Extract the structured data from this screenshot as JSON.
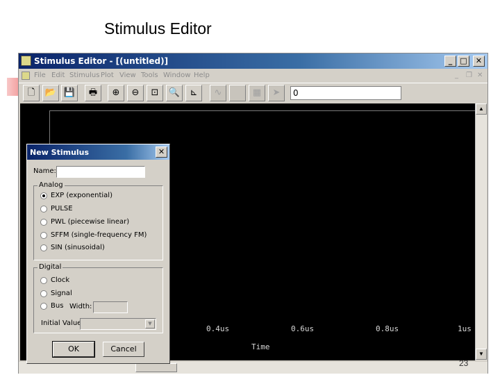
{
  "slide": {
    "title": "Stimulus Editor",
    "page_number": "23"
  },
  "window": {
    "title": "Stimulus Editor - [(untitled)]",
    "controls": {
      "minimize": "_",
      "maximize": "□",
      "close": "✕"
    },
    "mdi_controls": {
      "minimize": "_",
      "restore": "❐",
      "close": "✕"
    }
  },
  "menu": [
    "File",
    "Edit",
    "Stimulus",
    "Plot",
    "View",
    "Tools",
    "Window",
    "Help"
  ],
  "toolbar": {
    "buttons": [
      {
        "name": "new-file-button",
        "icon": "new-file-icon",
        "glyph": "🗋",
        "enabled": true
      },
      {
        "name": "open-button",
        "icon": "folder-open-icon",
        "glyph": "📂",
        "enabled": true
      },
      {
        "name": "save-button",
        "icon": "floppy-icon",
        "glyph": "💾",
        "enabled": true
      },
      {
        "name": "print-button",
        "icon": "printer-icon",
        "glyph": "🖶",
        "enabled": true
      },
      {
        "name": "zoom-in-button",
        "icon": "zoom-in-icon",
        "glyph": "⊕",
        "enabled": true
      },
      {
        "name": "zoom-out-button",
        "icon": "zoom-out-icon",
        "glyph": "⊖",
        "enabled": true
      },
      {
        "name": "zoom-area-button",
        "icon": "zoom-area-icon",
        "glyph": "⊡",
        "enabled": true
      },
      {
        "name": "zoom-fit-button",
        "icon": "zoom-fit-icon",
        "glyph": "🔍",
        "enabled": true
      },
      {
        "name": "axis-settings-button",
        "icon": "axis-icon",
        "glyph": "⊾",
        "enabled": true
      },
      {
        "name": "add-trace-button",
        "icon": "waveform-icon",
        "glyph": "∿",
        "enabled": false
      },
      {
        "name": "blank-tool-button",
        "icon": "blank-icon",
        "glyph": "",
        "enabled": false
      },
      {
        "name": "grid-tool-button",
        "icon": "grid-icon",
        "glyph": "▦",
        "enabled": false
      },
      {
        "name": "pointer-tool-button",
        "icon": "pointer-icon",
        "glyph": "➤",
        "enabled": false
      }
    ],
    "time_input_value": "0"
  },
  "plot": {
    "x_ticks": [
      "0.4us",
      "0.6us",
      "0.8us",
      "1us"
    ],
    "x_axis_title": "Time",
    "background": "#000000"
  },
  "dialog": {
    "title": "New Stimulus",
    "name_label": "Name:",
    "name_value": "",
    "analog_group": "Analog",
    "analog_options": [
      {
        "label": "EXP (exponential)",
        "selected": true
      },
      {
        "label": "PULSE",
        "selected": false
      },
      {
        "label": "PWL (piecewise linear)",
        "selected": false
      },
      {
        "label": "SFFM (single-frequency FM)",
        "selected": false
      },
      {
        "label": "SIN (sinusoidal)",
        "selected": false
      }
    ],
    "digital_group": "Digital",
    "digital_options": [
      {
        "label": "Clock",
        "selected": false
      },
      {
        "label": "Signal",
        "selected": false
      },
      {
        "label": "Bus",
        "selected": false
      }
    ],
    "width_label": "Width:",
    "initial_value_label": "Initial Value:",
    "ok_label": "OK",
    "cancel_label": "Cancel"
  },
  "colors": {
    "title_bar": "#0a246a",
    "window_face": "#d4d0c8",
    "plot_background": "#000000"
  }
}
